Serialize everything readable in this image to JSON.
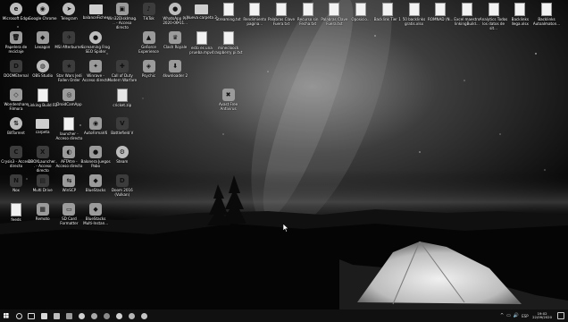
{
  "desktop": {
    "icons": [
      {
        "label": "Microsoft Edge",
        "type": "round",
        "glyph": "e"
      },
      {
        "label": "Google Chrome",
        "type": "round",
        "glyph": "◉"
      },
      {
        "label": "Telegram",
        "type": "round",
        "glyph": "➤"
      },
      {
        "label": "balanceFiches",
        "type": "folder",
        "glyph": ""
      },
      {
        "label": "Win32DiskImag... - Acceso directo",
        "type": "app",
        "glyph": "▣"
      },
      {
        "label": "TikTok",
        "type": "dark",
        "glyph": "♪"
      },
      {
        "label": "WhatsApp PH 2020-06-11...",
        "type": "round",
        "glyph": "●"
      },
      {
        "label": "Nueva carpeta 2",
        "type": "folder",
        "glyph": ""
      },
      {
        "label": "Streaming.txt",
        "type": "doc",
        "glyph": ""
      },
      {
        "label": "Rendimiento pagina...",
        "type": "doc",
        "glyph": ""
      },
      {
        "label": "Palabras Clave Fuera.txt",
        "type": "doc",
        "glyph": ""
      },
      {
        "label": "Recurso sin Fecha.txt",
        "type": "doc",
        "glyph": ""
      },
      {
        "label": "Palabras Clave Fuera.txt",
        "type": "doc",
        "glyph": ""
      },
      {
        "label": "Oposicio...",
        "type": "doc",
        "glyph": ""
      },
      {
        "label": "Backlink Tier 1",
        "type": "doc",
        "glyph": ""
      },
      {
        "label": "50 backlinks gratis.xlsx",
        "type": "doc",
        "glyph": ""
      },
      {
        "label": "ROMNAD (N...",
        "type": "doc",
        "glyph": ""
      },
      {
        "label": "Excel maestro linkingBuild...",
        "type": "doc",
        "glyph": ""
      },
      {
        "label": "Analytics Todos los datos de sit...",
        "type": "doc",
        "glyph": ""
      },
      {
        "label": "Backlinks llega.xlsx",
        "type": "doc",
        "glyph": ""
      },
      {
        "label": "Backlinks Autoalmaton...",
        "type": "doc",
        "glyph": ""
      },
      {
        "label": "Papelera de reciclaje",
        "type": "app",
        "glyph": "🗑"
      },
      {
        "label": "Lexagon",
        "type": "app",
        "glyph": "◆"
      },
      {
        "label": "MSI Afterburner",
        "type": "dark",
        "glyph": "✈"
      },
      {
        "label": "Screaming Frog SEO Spider",
        "type": "round",
        "glyph": "●"
      },
      {
        "label": "GeForce Experience",
        "type": "app",
        "glyph": "▲"
      },
      {
        "label": "Clash Royale",
        "type": "app",
        "glyph": "♛"
      },
      {
        "label": "esto es una prueba.mpv4",
        "type": "doc",
        "glyph": ""
      },
      {
        "label": "minecloock raspberry pi.txt",
        "type": "doc",
        "glyph": ""
      },
      {
        "label": "DOOMEternal",
        "type": "dark",
        "glyph": "D"
      },
      {
        "label": "OBS Studio",
        "type": "round",
        "glyph": "◍"
      },
      {
        "label": "Star Wars Jedi Fallen Order",
        "type": "dark",
        "glyph": "★"
      },
      {
        "label": "Winrave - Acceso directo",
        "type": "app",
        "glyph": "✦"
      },
      {
        "label": "Call of Duty Modern Warfare",
        "type": "dark",
        "glyph": "✚"
      },
      {
        "label": "Psychic",
        "type": "app",
        "glyph": "◈"
      },
      {
        "label": "4kwnloader 2",
        "type": "app",
        "glyph": "⬇"
      },
      {
        "label": "Wondershare Filmora",
        "type": "app",
        "glyph": "◇"
      },
      {
        "label": "Linking Build FB",
        "type": "doc",
        "glyph": ""
      },
      {
        "label": "DroidCamApp",
        "type": "app",
        "glyph": "◎"
      },
      {
        "label": "cricket.zip",
        "type": "zip",
        "glyph": ""
      },
      {
        "label": "Avast Free Antivirus",
        "type": "app",
        "glyph": "✖"
      },
      {
        "label": "BitTorrent",
        "type": "round",
        "glyph": "⇅"
      },
      {
        "label": "carpeta",
        "type": "folder",
        "glyph": ""
      },
      {
        "label": "launcher - Acceso directo",
        "type": "doc",
        "glyph": ""
      },
      {
        "label": "AutoFirmaV6",
        "type": "app",
        "glyph": "◉"
      },
      {
        "label": "Battlefield V",
        "type": "dark",
        "glyph": "V"
      },
      {
        "label": "Crysis3 - Acceso directo",
        "type": "dark",
        "glyph": "C"
      },
      {
        "label": "DBOXLauncher... - Acceso directo",
        "type": "dark",
        "glyph": "X"
      },
      {
        "label": "AFTAtre - Acceso directo",
        "type": "app",
        "glyph": "◐"
      },
      {
        "label": "Balonera Juegos Pabo",
        "type": "app",
        "glyph": "●"
      },
      {
        "label": "Steam",
        "type": "round",
        "glyph": "⚙"
      },
      {
        "label": "Nox",
        "type": "dark",
        "glyph": "N"
      },
      {
        "label": "Multi Drive",
        "type": "dark",
        "glyph": "▤"
      },
      {
        "label": "WinSCP",
        "type": "app",
        "glyph": "⇆"
      },
      {
        "label": "BlueStacks",
        "type": "app",
        "glyph": "◆"
      },
      {
        "label": "Doom 2016 (Vulkan)",
        "type": "dark",
        "glyph": "D"
      },
      {
        "label": "feeds",
        "type": "doc",
        "glyph": ""
      },
      {
        "label": "Remoto",
        "type": "app",
        "glyph": "▦"
      },
      {
        "label": "SD Card Formatter",
        "type": "app",
        "glyph": "▭"
      },
      {
        "label": "BlueStacks Multi-Instan...",
        "type": "app",
        "glyph": "◆"
      }
    ]
  },
  "taskbar": {
    "items": [
      "start-button",
      "search",
      "task-view",
      "file-explorer",
      "store",
      "mail",
      "chrome",
      "edge",
      "steam",
      "spotify",
      "discord",
      "whatsapp"
    ],
    "tray": {
      "chevron": "^",
      "volume": "🔊",
      "network": "▭",
      "lang": "ESP"
    },
    "time": "19:02",
    "date": "22/09/2020"
  }
}
